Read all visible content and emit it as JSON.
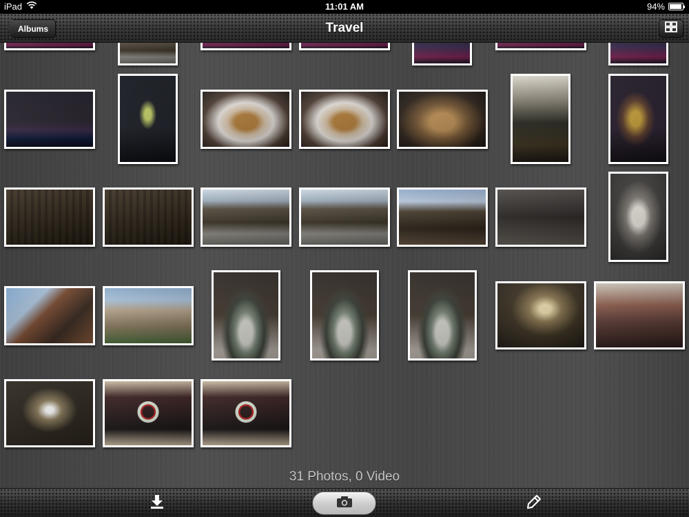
{
  "status": {
    "device": "iPad",
    "time": "11:01 AM",
    "battery_text": "94%",
    "battery_level": 0.94
  },
  "nav": {
    "back_label": "Albums",
    "title": "Travel",
    "grid_icon": "grid-icon"
  },
  "photos_count_text": "31 Photos, 0 Video",
  "toolbar": {
    "left_icon": "download-icon",
    "center_icon": "camera-icon",
    "right_icon": "pencil-icon"
  },
  "colors": {
    "bar_dark": "#2a2a2a",
    "content_gray": "#464646",
    "count_text": "#c4c4c4",
    "photo_border": "#ffffff"
  }
}
